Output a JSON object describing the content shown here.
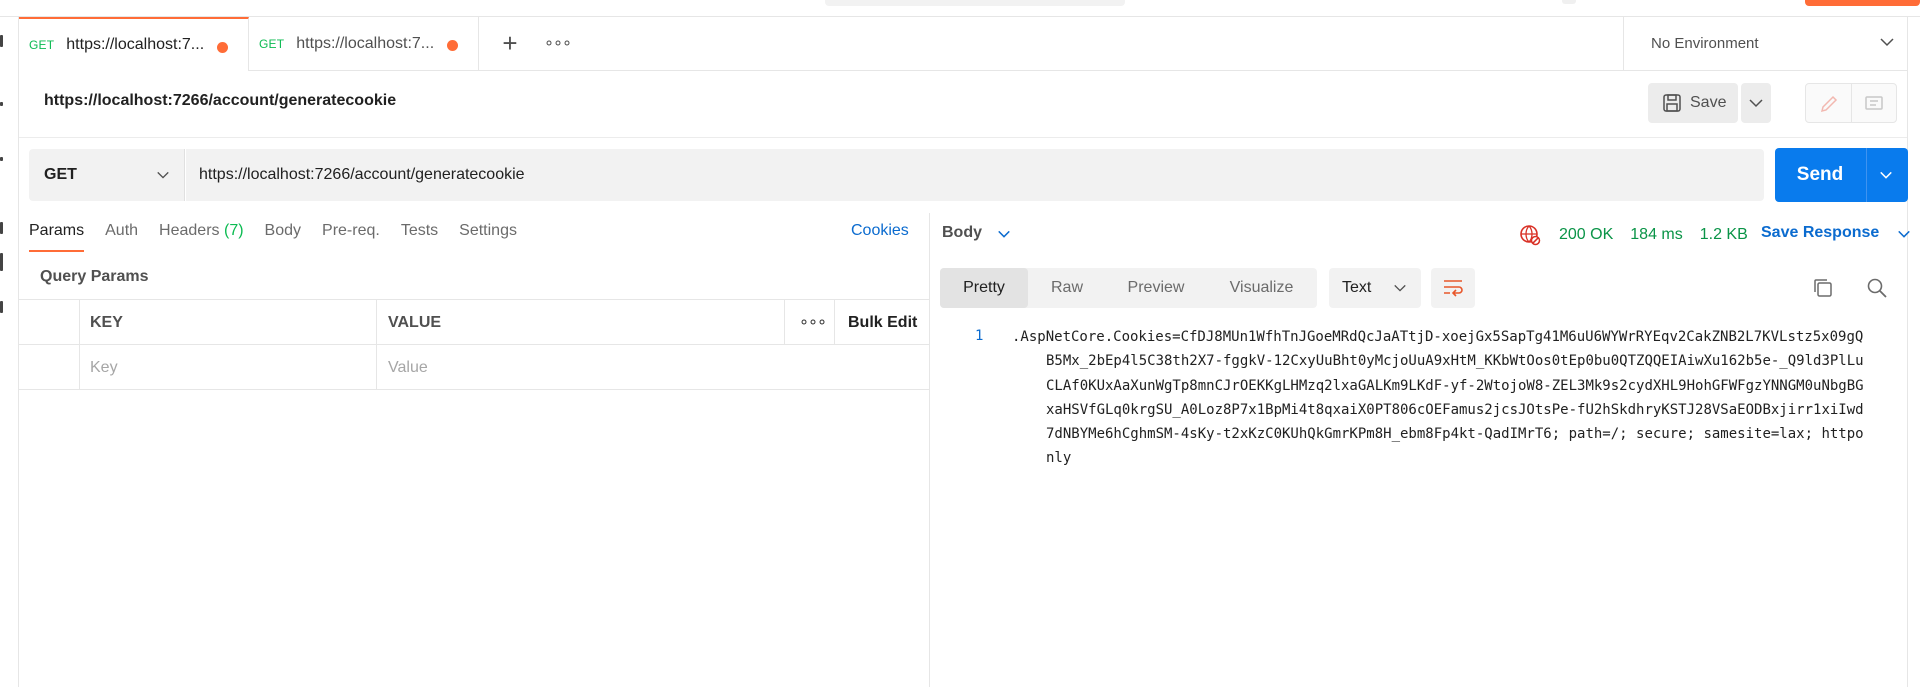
{
  "tabs": [
    {
      "method": "GET",
      "title": "https://localhost:7...",
      "unsaved": true,
      "active": true
    },
    {
      "method": "GET",
      "title": "https://localhost:7...",
      "unsaved": true,
      "active": false
    }
  ],
  "environment": {
    "label": "No Environment"
  },
  "request": {
    "name": "https://localhost:7266/account/generatecookie",
    "method": "GET",
    "url": "https://localhost:7266/account/generatecookie",
    "save_label": "Save",
    "send_label": "Send"
  },
  "request_tabs": {
    "params": "Params",
    "auth": "Auth",
    "headers": "Headers",
    "headers_count": "(7)",
    "body": "Body",
    "prereq": "Pre-req.",
    "tests": "Tests",
    "settings": "Settings",
    "cookies": "Cookies"
  },
  "query_params": {
    "title": "Query Params",
    "key_header": "KEY",
    "value_header": "VALUE",
    "bulk_edit": "Bulk Edit",
    "key_placeholder": "Key",
    "value_placeholder": "Value"
  },
  "response": {
    "body_selector": "Body",
    "status": "200 OK",
    "time": "184 ms",
    "size": "1.2 KB",
    "save_response": "Save Response",
    "view_tabs": [
      "Pretty",
      "Raw",
      "Preview",
      "Visualize"
    ],
    "format": "Text",
    "line_number": "1",
    "body_text": ".AspNetCore.Cookies=CfDJ8MUn1WfhTnJGoeMRdQcJaATtjD-xoejGx5SapTg41M6uU6WYWrRYEqv2CakZNB2L7KVLstz5x09gQB5Mx_2bEp4l5C38th2X7-fggkV-12CxyUuBht0yMcjoUuA9xHtM_KKbWtOos0tEp0bu0QTZQQEIAiwXu162b5e-_Q9ld3PlLuCLAf0KUxAaXunWgTp8mnCJrOEKKgLHMzq2lxaGALKm9LKdF-yf-2WtojoW8-ZEL3Mk9s2cydXHL9HohGFWFgzYNNGM0uNbgBGxaHSVfGLq0krgSU_A0Loz8P7x1BpMi4t8qxaiX0PT806cOEFamus2jcsJOtsPe-fU2hSkdhryKSTJ28VSaEODBxjirr1xiIwd7dNBYMe6hCghmSM-4sKy-t2xKzC0KUhQkGmrKPm8H_ebm8Fp4kt-QadIMrT6; path=/; secure; samesite=lax; httponly"
  },
  "colors": {
    "accent": "#ff6c37",
    "send": "#097bed",
    "get_method": "#0cbb52",
    "status_ok": "#0a9447",
    "link": "#0b6bcf"
  }
}
